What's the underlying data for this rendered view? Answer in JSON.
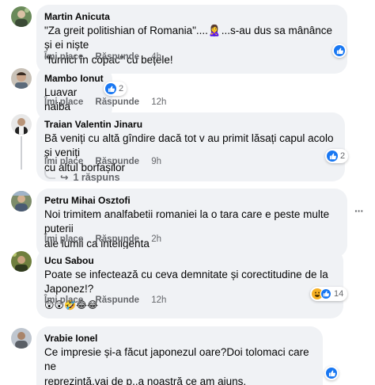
{
  "colors": {
    "like_blue": "#1877f2",
    "haha_yellow": "#f7b125",
    "bubble_bg": "#f0f2f5",
    "meta_gray": "#65676b"
  },
  "comments": [
    {
      "author": "Martin Anicuta",
      "lines": [
        "\"Za greit politishian of Romania\"....🙎‍♀️...s-au dus sa mânânce și ei niște",
        "\"furnici în copac\" cu bețele!"
      ],
      "like": "Îmi place",
      "reply": "Răspunde",
      "time": "4h",
      "reaction_icons": [
        "like-icon"
      ],
      "reaction_count": ""
    },
    {
      "author": "Mambo Ionut",
      "lines": [
        "Luavar naiba"
      ],
      "like": "Îmi place",
      "reply": "Răspunde",
      "time": "12h",
      "reaction_icons": [
        "like-icon"
      ],
      "reaction_count": "2"
    },
    {
      "author": "Traian Valentin Jinaru",
      "lines": [
        "Bă veniți cu altă gîndire dacă tot v au primit lăsați capul acolo și veniți",
        "cu altul borfașilor"
      ],
      "like": "Îmi place",
      "reply": "Răspunde",
      "time": "9h",
      "reaction_icons": [
        "like-icon"
      ],
      "reaction_count": "2",
      "replies_label": "1 răspuns"
    },
    {
      "author": "Petru Mihai Osztofi",
      "lines": [
        "Noi trimitem analfabetii romaniei la o tara care e peste multe puterii",
        "ale lumii ca inteligenta"
      ],
      "like": "Îmi place",
      "reply": "Răspunde",
      "time": "2h",
      "more": "···"
    },
    {
      "author": "Ucu Sabou",
      "lines": [
        "Poate se infectează cu ceva demnitate și corectitudine de la Japonez!?"
      ],
      "emoji_line": "😲😲🤣😂😂",
      "like": "Îmi place",
      "reply": "Răspunde",
      "time": "12h",
      "reaction_icons": [
        "haha-icon",
        "like-icon"
      ],
      "reaction_count": "14"
    },
    {
      "author": "Vrabie Ionel",
      "lines": [
        "Ce impresie și-a făcut japonezul oare?Doi tolomaci care ne",
        "reprezintă,vai de p..a noastră ce am ajuns."
      ],
      "reaction_icons": [
        "like-icon"
      ]
    }
  ]
}
